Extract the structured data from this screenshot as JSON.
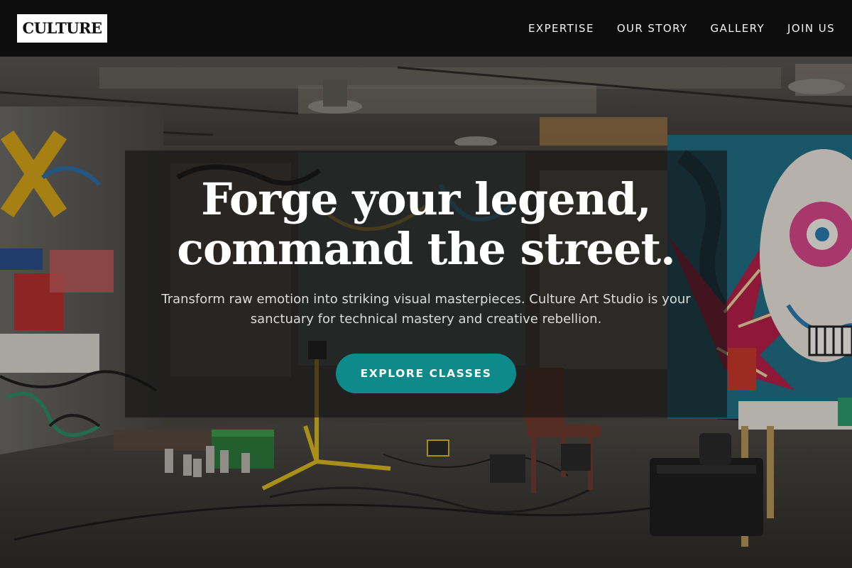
{
  "header": {
    "logo_text": "CULTURE",
    "nav": [
      {
        "label": "EXPERTISE"
      },
      {
        "label": "OUR STORY"
      },
      {
        "label": "GALLERY"
      },
      {
        "label": "JOIN US"
      }
    ]
  },
  "hero": {
    "title_line1": "Forge your legend,",
    "title_line2": "command the street.",
    "subtitle": "Transform raw emotion into striking visual masterpieces. Culture Art Studio is your sanctuary for technical mastery and creative rebellion.",
    "cta_label": "EXPLORE CLASSES"
  },
  "colors": {
    "accent": "#0f8a8a",
    "header_bg": "#0c0c0c",
    "text_light": "#ffffff"
  }
}
